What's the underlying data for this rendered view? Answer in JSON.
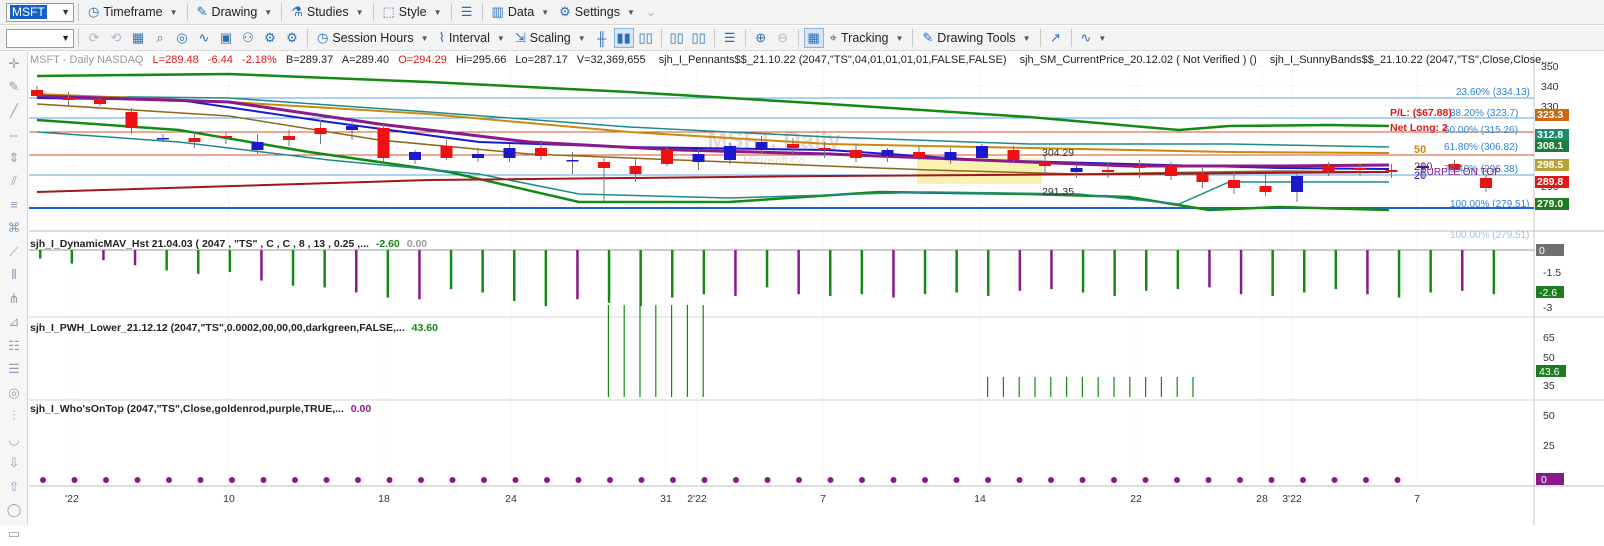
{
  "toolbar1": {
    "symbol": "MSFT",
    "items": [
      {
        "key": "timeframe",
        "label": "Timeframe",
        "icon": "clock-icon"
      },
      {
        "key": "drawing",
        "label": "Drawing",
        "icon": "pencil-icon"
      },
      {
        "key": "studies",
        "label": "Studies",
        "icon": "flask-icon"
      },
      {
        "key": "style",
        "label": "Style",
        "icon": "style-icon"
      },
      {
        "key": "data",
        "label": "Data",
        "icon": "bar-chart-icon"
      },
      {
        "key": "settings",
        "label": "Settings",
        "icon": "gear-icon"
      }
    ]
  },
  "toolbar2": {
    "session_hours": "Session Hours",
    "interval": "Interval",
    "scaling": "Scaling",
    "tracking": "Tracking",
    "drawing_tools": "Drawing Tools"
  },
  "chart": {
    "header": {
      "symbol_line": "MSFT - Daily  NASDAQ",
      "low": "L=289.48",
      "change": "-6.44",
      "change_pct": "-2.18%",
      "bid": "B=289.37",
      "ask": "A=289.40",
      "open": "O=294.29",
      "high": "Hi=295.66",
      "lo": "Lo=287.17",
      "volume": "V=32,369,655",
      "study1": "sjh_I_Pennants$$_21.10.22 (2047,\"TS\",04,01,01,01,01,FALSE,FALSE)",
      "study2": "sjh_SM_CurrentPrice_20.12.02 ( Not Verified ) ()",
      "study3": "sjh_I_SunnyBands$$_21.10.22 (2047,\"TS\",Close,Close,..."
    },
    "watermark": "MSFT, Daily",
    "watermark_sub": "Microsoft Co",
    "price_axis": [
      "350",
      "340",
      "330",
      "310",
      "300",
      "290",
      "280"
    ],
    "price_tags": [
      {
        "text": "323.3",
        "bg": "#c96a12"
      },
      {
        "text": "312.8",
        "bg": "#1e8a6e"
      },
      {
        "text": "308.1",
        "bg": "#1e7c3a"
      },
      {
        "text": "298.5",
        "bg": "#b9a23a"
      },
      {
        "text": "289.8",
        "bg": "#e01818"
      },
      {
        "text": "279.0",
        "bg": "#1e7c1e"
      }
    ],
    "fib_labels": [
      "23.60% (334.13)",
      "38.20% (323.7)",
      "50.00% (315.26)",
      "61.80% (306.82)",
      "76.40% (296.38)",
      "100.00% (279.51)",
      "100.00% (279.51)"
    ],
    "pnl": "P/L: ($67.88)",
    "net_long": "Net Long: 2",
    "ma_labels": {
      "fifty": "50",
      "two_hundred": "200",
      "twenty": "20",
      "purple_on_top": "PURPLE ON TOP"
    },
    "pennant_high": "304.29",
    "pennant_low": "291.35",
    "dates": [
      "'22",
      "10",
      "18",
      "24",
      "31",
      "2'22",
      "7",
      "14",
      "22",
      "28",
      "3'22",
      "7"
    ],
    "colors": {
      "up": "#1a1acc",
      "down": "#ee1111",
      "green": "#138a13",
      "purple": "#8a1a8a"
    }
  },
  "chart_data": {
    "type": "candlestick",
    "title": "MSFT - Daily  NASDAQ",
    "ylim": [
      275,
      355
    ],
    "last": {
      "open": 294.29,
      "high": 295.66,
      "low": 287.17,
      "close": 289.48,
      "change": -6.44
    },
    "candles": [
      {
        "o": 338,
        "h": 340,
        "l": 334,
        "c": 335
      },
      {
        "o": 334,
        "h": 337,
        "l": 330,
        "c": 333
      },
      {
        "o": 333,
        "h": 334,
        "l": 330,
        "c": 331
      },
      {
        "o": 327,
        "h": 329,
        "l": 316,
        "c": 319
      },
      {
        "o": 314,
        "h": 316,
        "l": 312,
        "c": 314
      },
      {
        "o": 314,
        "h": 317,
        "l": 309,
        "c": 312
      },
      {
        "o": 315,
        "h": 317,
        "l": 311,
        "c": 314
      },
      {
        "o": 308,
        "h": 316,
        "l": 306,
        "c": 312
      },
      {
        "o": 315,
        "h": 318,
        "l": 310,
        "c": 313
      },
      {
        "o": 319,
        "h": 323,
        "l": 311,
        "c": 316
      },
      {
        "o": 318,
        "h": 322,
        "l": 313,
        "c": 320
      },
      {
        "o": 319,
        "h": 321,
        "l": 302,
        "c": 304
      },
      {
        "o": 303,
        "h": 308,
        "l": 301,
        "c": 307
      },
      {
        "o": 310,
        "h": 313,
        "l": 303,
        "c": 304
      },
      {
        "o": 304,
        "h": 309,
        "l": 302,
        "c": 306
      },
      {
        "o": 304,
        "h": 311,
        "l": 302,
        "c": 309
      },
      {
        "o": 309,
        "h": 313,
        "l": 303,
        "c": 305
      },
      {
        "o": 303,
        "h": 307,
        "l": 296,
        "c": 303
      },
      {
        "o": 302,
        "h": 304,
        "l": 282,
        "c": 299
      },
      {
        "o": 300,
        "h": 304,
        "l": 292,
        "c": 296
      },
      {
        "o": 308,
        "h": 310,
        "l": 300,
        "c": 301
      },
      {
        "o": 302,
        "h": 308,
        "l": 298,
        "c": 306
      },
      {
        "o": 303,
        "h": 312,
        "l": 301,
        "c": 310
      },
      {
        "o": 308,
        "h": 315,
        "l": 306,
        "c": 312
      },
      {
        "o": 311,
        "h": 314,
        "l": 306,
        "c": 309
      },
      {
        "o": 309,
        "h": 312,
        "l": 304,
        "c": 308
      },
      {
        "o": 308,
        "h": 311,
        "l": 302,
        "c": 304
      },
      {
        "o": 305,
        "h": 309,
        "l": 302,
        "c": 308
      },
      {
        "o": 307,
        "h": 310,
        "l": 303,
        "c": 304
      },
      {
        "o": 303,
        "h": 309,
        "l": 301,
        "c": 307
      },
      {
        "o": 304,
        "h": 311,
        "l": 303,
        "c": 310
      },
      {
        "o": 308,
        "h": 310,
        "l": 302,
        "c": 303
      },
      {
        "o": 302,
        "h": 306,
        "l": 296,
        "c": 300
      },
      {
        "o": 297,
        "h": 301,
        "l": 294,
        "c": 299
      },
      {
        "o": 298,
        "h": 302,
        "l": 294,
        "c": 297
      },
      {
        "o": 300,
        "h": 303,
        "l": 294,
        "c": 299
      },
      {
        "o": 300,
        "h": 302,
        "l": 293,
        "c": 295
      },
      {
        "o": 296,
        "h": 299,
        "l": 289,
        "c": 292
      },
      {
        "o": 293,
        "h": 297,
        "l": 286,
        "c": 289
      },
      {
        "o": 290,
        "h": 296,
        "l": 285,
        "c": 287
      },
      {
        "o": 287,
        "h": 296,
        "l": 282,
        "c": 295
      },
      {
        "o": 300,
        "h": 302,
        "l": 295,
        "c": 297
      },
      {
        "o": 299,
        "h": 301,
        "l": 295,
        "c": 298
      },
      {
        "o": 298,
        "h": 301,
        "l": 294,
        "c": 297
      },
      {
        "o": 299,
        "h": 302,
        "l": 294,
        "c": 300
      },
      {
        "o": 301,
        "h": 303,
        "l": 296,
        "c": 298
      },
      {
        "o": 294,
        "h": 296,
        "l": 287,
        "c": 289
      }
    ],
    "sub_charts": [
      {
        "title": "sjh_I_DynamicMAV_Hst 21.04.03 ( 2047 , \"TS\" , C , C ,  8 , 13 , 0.25 ,...",
        "value1": "-2.60",
        "value2": "0.00",
        "axis": [
          "0",
          "-1.5",
          "-3"
        ],
        "last_tag": "-2.6",
        "values": [
          -0.5,
          -0.8,
          -0.6,
          -0.9,
          -1.2,
          -1.4,
          -1.3,
          -1.8,
          -2.1,
          -2.2,
          -2.5,
          -2.8,
          -2.9,
          -2.3,
          -2.5,
          -3.0,
          -3.3,
          -2.9,
          -3.1,
          -3.3,
          -2.8,
          -2.6,
          -2.7,
          -2.2,
          -2.6,
          -2.7,
          -2.6,
          -2.8,
          -2.6,
          -2.5,
          -2.7,
          -2.4,
          -2.3,
          -2.5,
          -2.7,
          -2.4,
          -2.3,
          -2.2,
          -2.6,
          -2.7,
          -2.5,
          -2.3,
          -2.6,
          -2.8,
          -2.5,
          -2.4,
          -2.6
        ]
      },
      {
        "title": "sjh_I_PWH_Lower_21.12.12 (2047,\"TS\",0.0002,00,00,00,darkgreen,FALSE,...",
        "value": "43.60",
        "axis": [
          "65",
          "50",
          "35"
        ],
        "last_tag": "43.6",
        "values": [
          0,
          0,
          0,
          0,
          0,
          0,
          0,
          0,
          0,
          0,
          0,
          0,
          0,
          0,
          0,
          0,
          0,
          0,
          0,
          0,
          0,
          0,
          0,
          0,
          0,
          0,
          0,
          0,
          0,
          0,
          0,
          0,
          0,
          0,
          0,
          0,
          70,
          70,
          70,
          70,
          70,
          70,
          70,
          0,
          0,
          0,
          0,
          0,
          0,
          0,
          0,
          0,
          0,
          0,
          0,
          0,
          0,
          0,
          0,
          0,
          42,
          42,
          42,
          42,
          42,
          42,
          42,
          42,
          42,
          42,
          44,
          44,
          44,
          44
        ]
      },
      {
        "title": "sjh_I_Who'sOnTop (2047,\"TS\",Close,goldenrod,purple,TRUE,...",
        "value": "0.00",
        "axis": [
          "50",
          "25",
          "0"
        ],
        "last_tag": "0"
      }
    ]
  }
}
